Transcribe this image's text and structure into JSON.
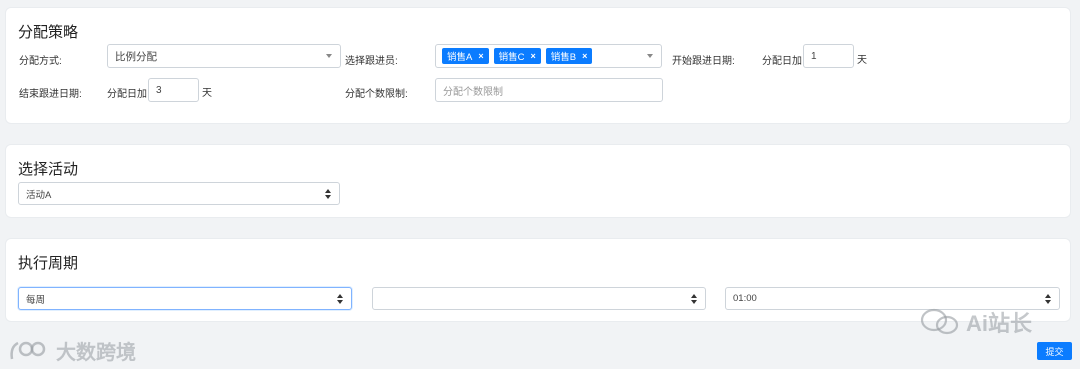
{
  "strategy": {
    "title": "分配策略",
    "method_label": "分配方式:",
    "method_value": "比例分配",
    "followers_label": "选择跟进员:",
    "followers": [
      "销售A",
      "销售C",
      "销售B"
    ],
    "tag_close": "×",
    "start_label": "开始跟进日期:",
    "start_prefix": "分配日加",
    "start_value": "1",
    "start_unit": "天",
    "end_label": "结束跟进日期:",
    "end_prefix": "分配日加",
    "end_value": "3",
    "end_unit": "天",
    "limit_label": "分配个数限制:",
    "limit_placeholder": "分配个数限制"
  },
  "activity": {
    "title": "选择活动",
    "selected": "活动A"
  },
  "schedule": {
    "title": "执行周期",
    "period": "每周",
    "day": "",
    "time": "01:00"
  },
  "submit_label": "提交",
  "watermarks": {
    "left": "大数跨境",
    "right": "Ai站长"
  }
}
